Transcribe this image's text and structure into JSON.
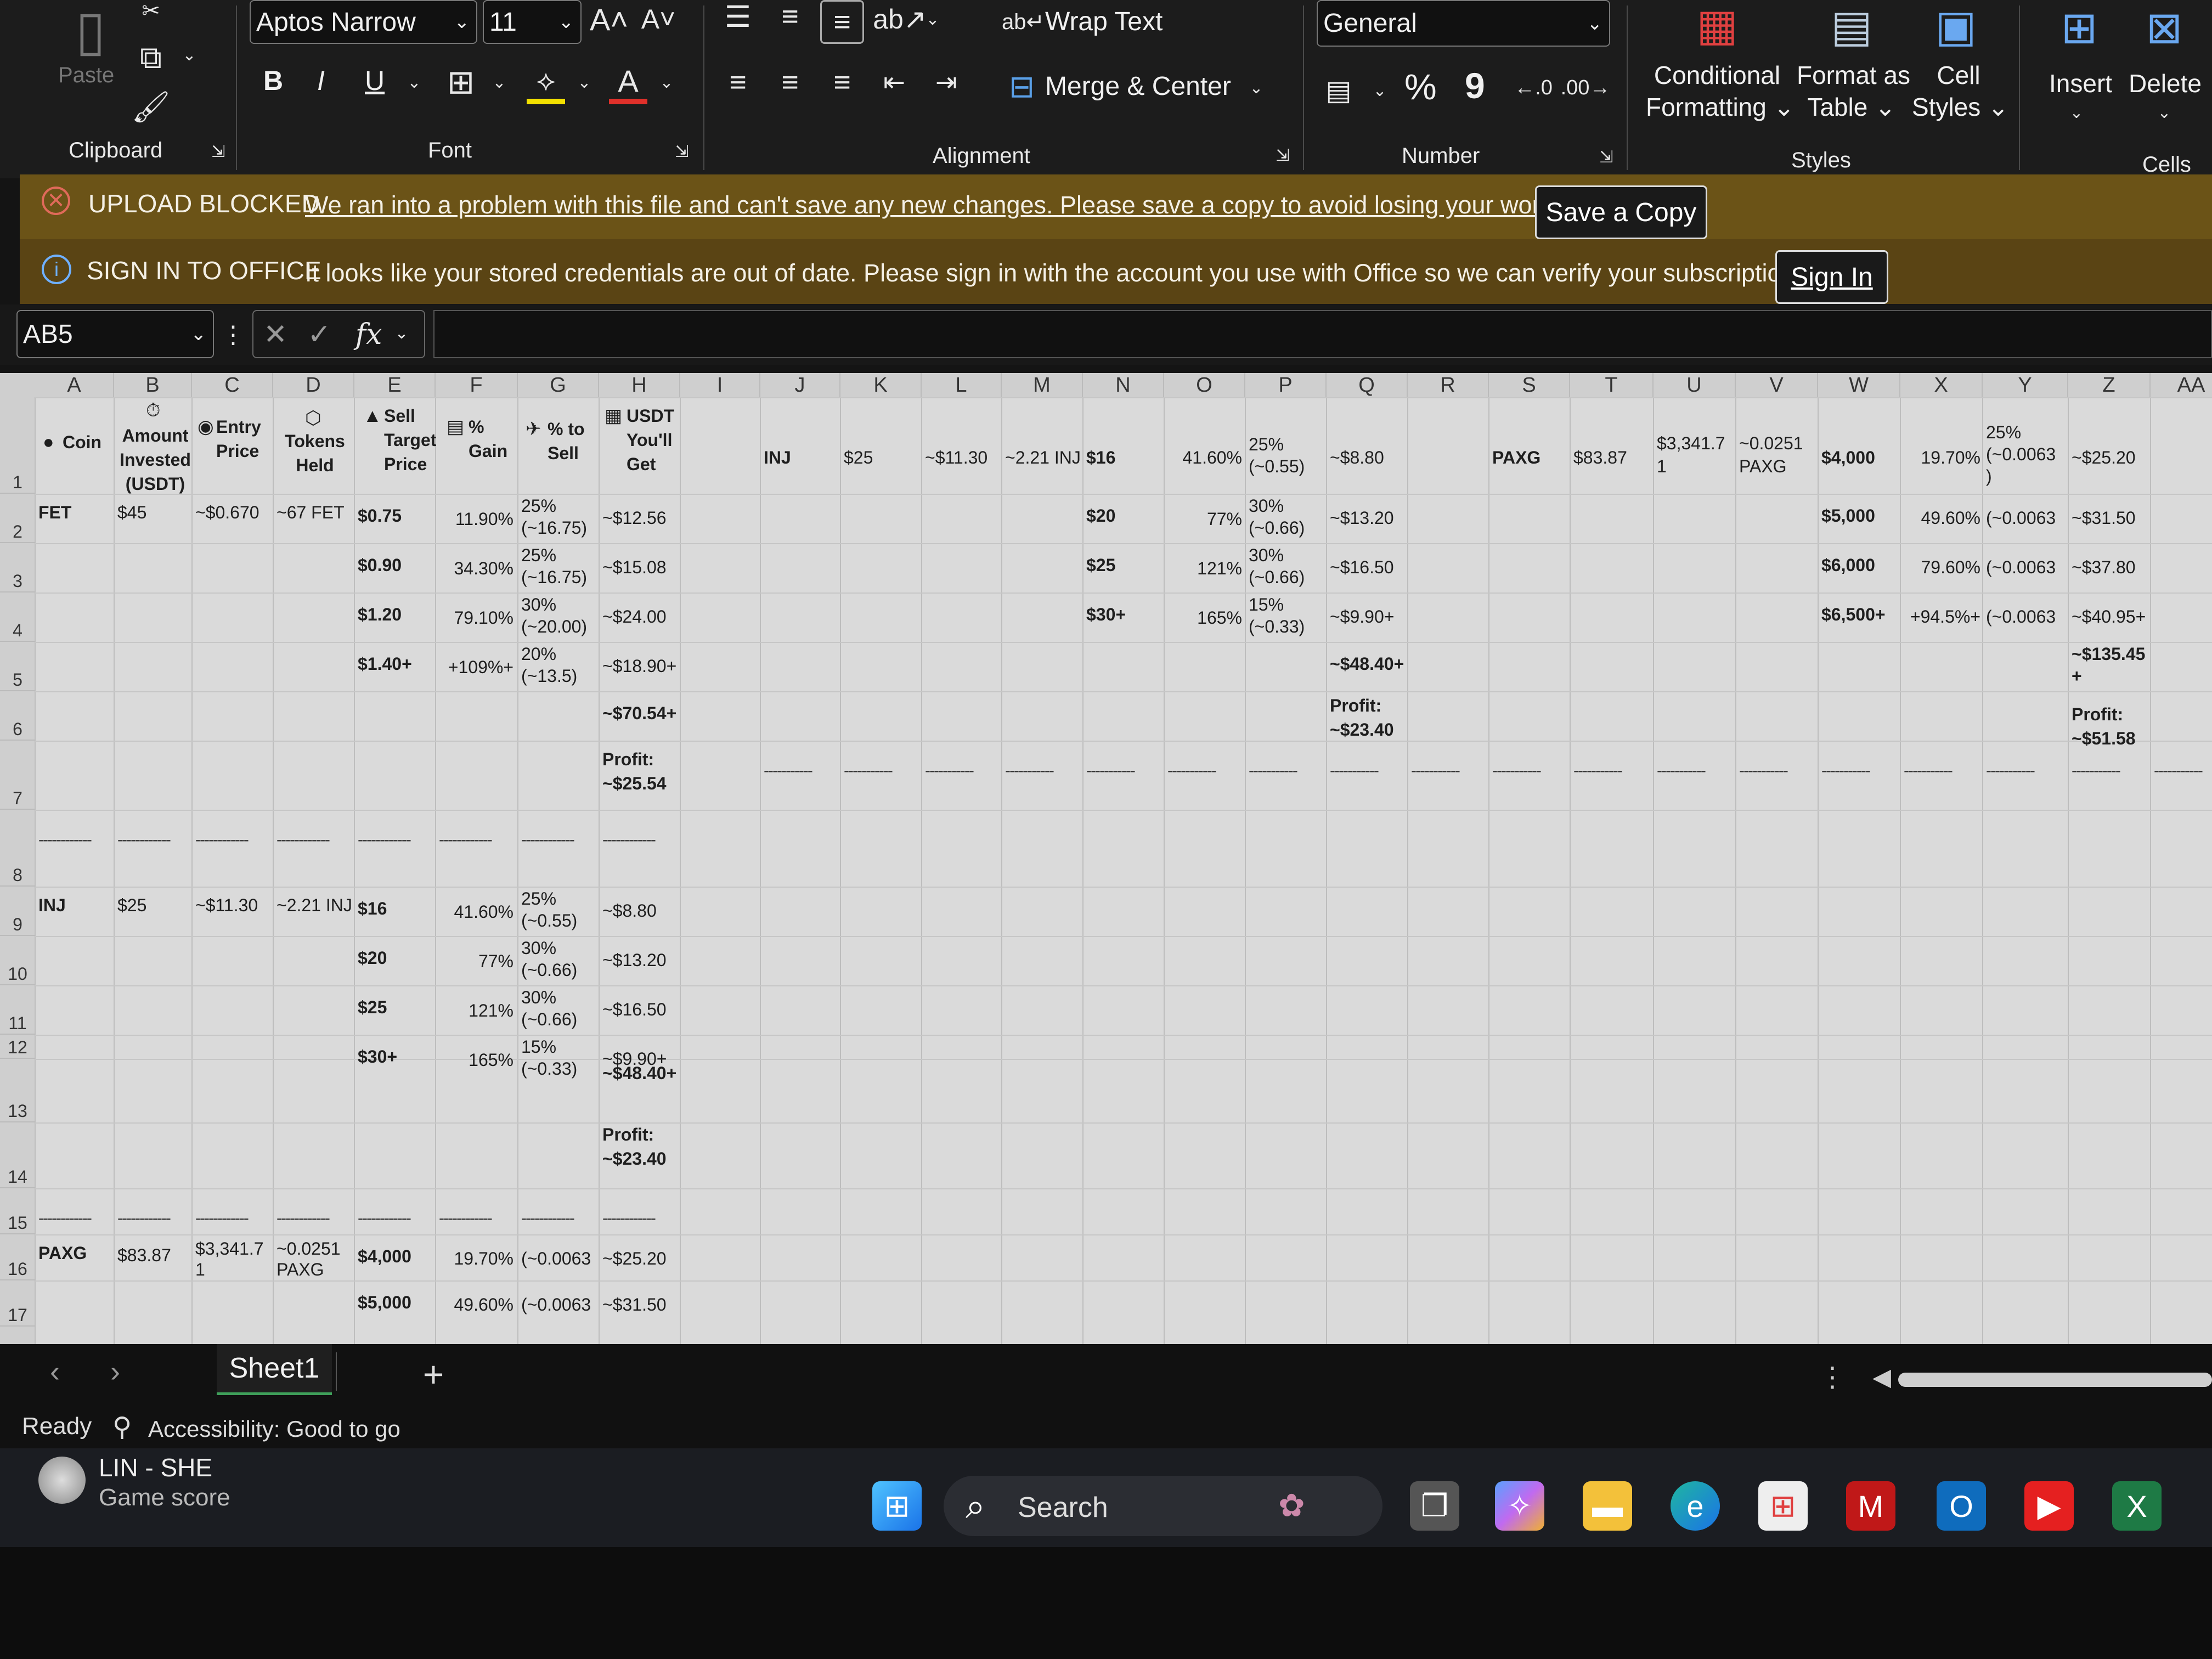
{
  "ribbon": {
    "clipboard": {
      "paste": "Paste",
      "label": "Clipboard"
    },
    "font": {
      "name": "Aptos Narrow",
      "size": "11",
      "label": "Font",
      "bold": "B",
      "italic": "I",
      "underline": "U"
    },
    "alignment": {
      "wrap": "Wrap Text",
      "merge": "Merge & Center",
      "label": "Alignment"
    },
    "number": {
      "format": "General",
      "percent": "%",
      "comma": "9",
      "label": "Number"
    },
    "styles": {
      "conditional": "Conditional\nFormatting",
      "conditional_l1": "Conditional",
      "conditional_l2": "Formatting",
      "format_table_l1": "Format as",
      "format_table_l2": "Table",
      "cell_styles_l1": "Cell",
      "cell_styles_l2": "Styles",
      "label": "Styles"
    },
    "cells": {
      "insert": "Insert",
      "delete": "Delete",
      "label": "Cells"
    }
  },
  "banners": {
    "upload": {
      "title": "UPLOAD BLOCKED",
      "message": "We ran into a problem with this file and can't save any new changes. Please save a copy to avoid losing your work.",
      "button": "Save a Copy"
    },
    "signin": {
      "title": "SIGN IN TO OFFICE",
      "message": "It looks like your stored credentials are out of date. Please sign in with the account you use with Office so we can verify your subscription.",
      "button": "Sign In"
    }
  },
  "formula_bar": {
    "name_box": "AB5",
    "fx": "fx",
    "value": ""
  },
  "columns": [
    "A",
    "B",
    "C",
    "D",
    "E",
    "F",
    "G",
    "H",
    "I",
    "J",
    "K",
    "L",
    "M",
    "N",
    "O",
    "P",
    "Q",
    "R",
    "S",
    "T",
    "U",
    "V",
    "W",
    "X",
    "Y",
    "Z",
    "AA"
  ],
  "rows": [
    "1",
    "2",
    "3",
    "4",
    "5",
    "6",
    "7",
    "8",
    "9",
    "10",
    "11",
    "12",
    "13",
    "14",
    "15",
    "16",
    "17"
  ],
  "headers": {
    "coin": "Coin",
    "amount": [
      "Amount",
      "Invested",
      "(USDT)"
    ],
    "entry": [
      "Entry",
      "Price"
    ],
    "tokens": [
      "Tokens",
      "Held"
    ],
    "sell_target": [
      "Sell",
      "Target",
      "Price"
    ],
    "gain": [
      "%",
      "Gain"
    ],
    "pct_sell": [
      "% to",
      "Sell"
    ],
    "usdt_get": [
      "USDT",
      "You'll",
      "Get"
    ]
  },
  "fet": {
    "coin": "FET",
    "amount": "$45",
    "entry": "~$0.670",
    "tokens": "~67 FET",
    "targets": [
      "$0.75",
      "$0.90",
      "$1.20",
      "$1.40+"
    ],
    "gains": [
      "11.90%",
      "34.30%",
      "79.10%",
      "+109%+"
    ],
    "sells": [
      [
        "25%",
        "(~16.75)"
      ],
      [
        "25%",
        "(~16.75)"
      ],
      [
        "30%",
        "(~20.00)"
      ],
      [
        "20%",
        "(~13.5)"
      ]
    ],
    "gets": [
      "~$12.56",
      "~$15.08",
      "~$24.00",
      "~$18.90+"
    ],
    "total": "~$70.54+",
    "profit": [
      "Profit:",
      "~$25.54"
    ]
  },
  "inj": {
    "coin": "INJ",
    "amount": "$25",
    "entry": "~$11.30",
    "tokens": "~2.21 INJ",
    "targets": [
      "$16",
      "$20",
      "$25",
      "$30+"
    ],
    "gains": [
      "41.60%",
      "77%",
      "121%",
      "165%"
    ],
    "sells": [
      [
        "25%",
        "(~0.55)"
      ],
      [
        "30%",
        "(~0.66)"
      ],
      [
        "30%",
        "(~0.66)"
      ],
      [
        "15%",
        "(~0.33)"
      ]
    ],
    "gets": [
      "~$8.80",
      "~$13.20",
      "~$16.50",
      "~$9.90+"
    ],
    "total": "~$48.40+",
    "profit": [
      "Profit:",
      "~$23.40"
    ]
  },
  "paxg": {
    "coin": "PAXG",
    "amount": "$83.87",
    "entry": [
      "$3,341.7",
      "1"
    ],
    "tokens": [
      "~0.0251",
      "PAXG"
    ],
    "targets": [
      "$4,000",
      "$5,000",
      "$6,000",
      "$6,500+"
    ],
    "gains": [
      "19.70%",
      "49.60%",
      "79.60%",
      "+94.5%+"
    ],
    "sells": [
      [
        "25%",
        "(~0.0063",
        ")"
      ],
      [
        "25%",
        "(~0.0063"
      ],
      [
        "25%",
        "(~0.0063"
      ],
      [
        "25%",
        "(~0.0063"
      ]
    ],
    "gets": [
      "~$25.20",
      "~$31.50",
      "~$37.80",
      "~$40.95+"
    ],
    "total": [
      "~$135.45",
      "+"
    ],
    "profit": [
      "Profit:",
      "~$51.58"
    ]
  },
  "sheet_tab": "Sheet1",
  "status": {
    "ready": "Ready",
    "accessibility": "Accessibility: Good to go"
  },
  "taskbar": {
    "widget_title": "LIN - SHE",
    "widget_sub": "Game score",
    "search": "Search"
  },
  "colors": {
    "banner": "#6b5317",
    "grid": "#dadada",
    "ribbon": "#1c1c1c"
  }
}
